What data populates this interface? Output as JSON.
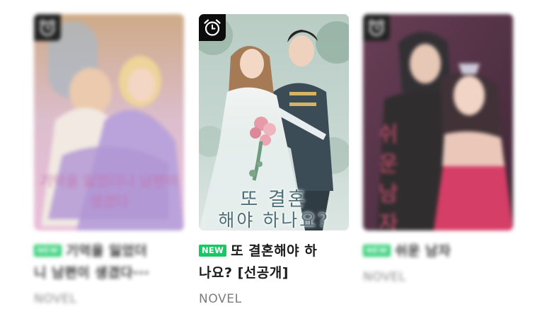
{
  "cards": [
    {
      "title_line1": "기억을 잃었더",
      "title_line2": "니 남편이 생겼다···",
      "badge": "NEW",
      "category": "NOVEL",
      "cover_text": "기억을 잃었더니 남편이 생겼다"
    },
    {
      "title_line1": "또 결혼해야 하",
      "title_line2": "나요? [선공개]",
      "badge": "NEW",
      "category": "NOVEL",
      "cover_title_line1": "또 결혼",
      "cover_title_line2": "해야 하나요?"
    },
    {
      "title_line1": "쉬운 남자",
      "badge": "NEW",
      "category": "NOVEL",
      "cover_text": "쉬운 남자"
    }
  ],
  "colors": {
    "new_badge": "#17c964",
    "title": "#1b1b1b",
    "category": "#7c7c7c"
  }
}
